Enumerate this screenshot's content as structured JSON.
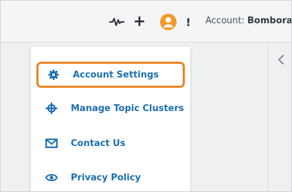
{
  "header": {
    "account_label": "Account:",
    "account_name": "Bombora",
    "plus_glyph": "+",
    "alert_glyph": "!"
  },
  "menu": {
    "items": [
      {
        "label": "Account Settings",
        "icon": "gear-icon",
        "selected": true
      },
      {
        "label": "Manage Topic Clusters",
        "icon": "crosshair-icon"
      },
      {
        "label": "Contact Us",
        "icon": "envelope-icon"
      },
      {
        "label": "Privacy Policy",
        "icon": "eye-icon"
      }
    ]
  },
  "colors": {
    "accent": "#1d6fb2",
    "highlight": "#e8811f",
    "avatar": "#f39a2b"
  }
}
